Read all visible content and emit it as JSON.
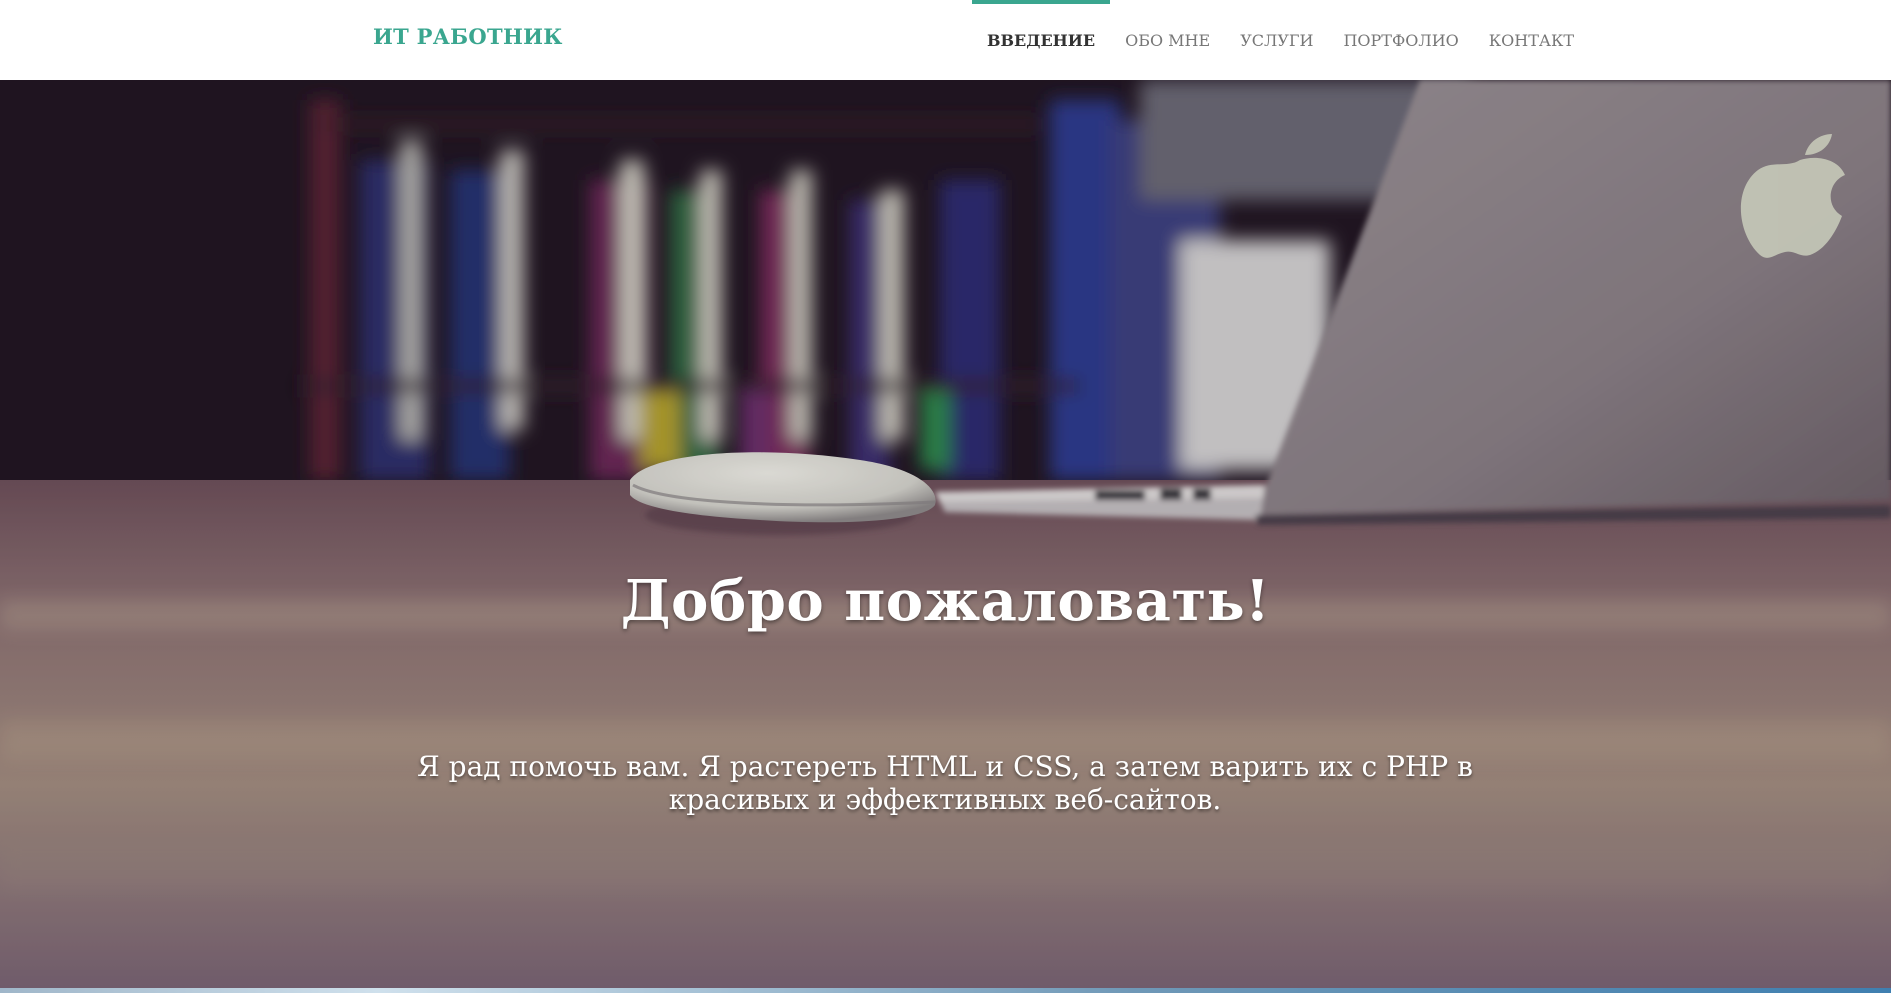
{
  "brand": "ИТ РАБОТНИК",
  "nav": {
    "items": [
      {
        "label": "ВВЕДЕНИЕ",
        "active": true
      },
      {
        "label": "ОБО МНЕ"
      },
      {
        "label": "УСЛУГИ"
      },
      {
        "label": "ПОРТФОЛИО"
      },
      {
        "label": "КОНТАКТ"
      }
    ]
  },
  "hero": {
    "title": "Добро пожаловать!",
    "text": "Я рад помочь вам. Я растереть HTML и CSS, а затем варить их с PHP в красивых и эффективных веб-сайтов."
  },
  "colors": {
    "accent": "#3aa68f",
    "nav_text": "#777777",
    "nav_active": "#333333"
  }
}
